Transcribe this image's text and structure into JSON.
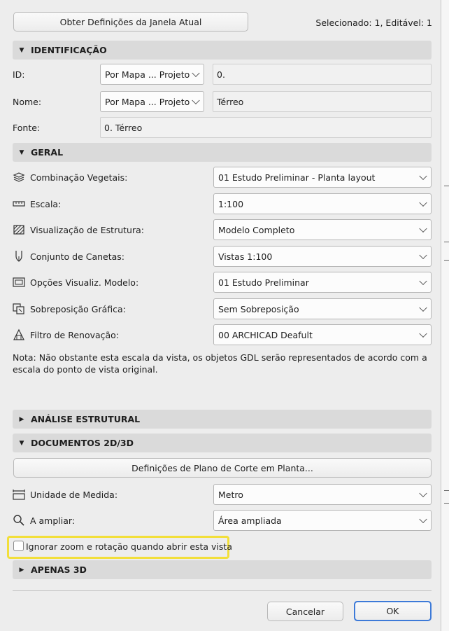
{
  "top": {
    "get_settings_button": "Obter Definições da Janela Atual",
    "selection_status": "Selecionado: 1, Editável: 1"
  },
  "identificacao": {
    "title": "IDENTIFICAÇÃO",
    "id_label": "ID:",
    "id_mode": "Por Mapa ... Projeto",
    "id_value": "0.",
    "name_label": "Nome:",
    "name_mode": "Por Mapa ... Projeto",
    "name_value": "Térreo",
    "source_label": "Fonte:",
    "source_value": "0. Térreo"
  },
  "geral": {
    "title": "GERAL",
    "rows": [
      {
        "label": "Combinação Vegetais:",
        "value": "01 Estudo Preliminar - Planta layout",
        "icon": "layer-combination-icon"
      },
      {
        "label": "Escala:",
        "value": "1:100",
        "icon": "scale-ruler-icon"
      },
      {
        "label": "Visualização de Estrutura:",
        "value": "Modelo Completo",
        "icon": "structure-display-icon"
      },
      {
        "label": "Conjunto de Canetas:",
        "value": "Vistas 1:100",
        "icon": "pen-set-icon"
      },
      {
        "label": "Opções Visualiz. Modelo:",
        "value": "01 Estudo Preliminar",
        "icon": "model-view-options-icon"
      },
      {
        "label": "Sobreposição Gráfica:",
        "value": "Sem Sobreposição",
        "icon": "graphic-override-icon"
      },
      {
        "label": "Filtro de Renovação:",
        "value": "00 ARCHICAD Deafult",
        "icon": "renovation-filter-icon"
      }
    ],
    "note": "Nota: Não obstante esta escala da vista, os objetos GDL serão representados de acordo com a escala do ponto de vista original."
  },
  "analise": {
    "title": "ANÁLISE ESTRUTURAL"
  },
  "documentos": {
    "title": "DOCUMENTOS 2D/3D",
    "cut_plane_button": "Definições de Plano de Corte em Planta...",
    "unit_label": "Unidade de Medida:",
    "unit_value": "Metro",
    "zoom_label": "A ampliar:",
    "zoom_value": "Área ampliada",
    "ignore_zoom_label": "Ignorar zoom e rotação quando abrir esta vista"
  },
  "apenas3d": {
    "title": "APENAS 3D"
  },
  "footer": {
    "cancel": "Cancelar",
    "ok": "OK"
  },
  "colors": {
    "highlight": "#f2df3a",
    "ok_border": "#3d7ad8"
  }
}
